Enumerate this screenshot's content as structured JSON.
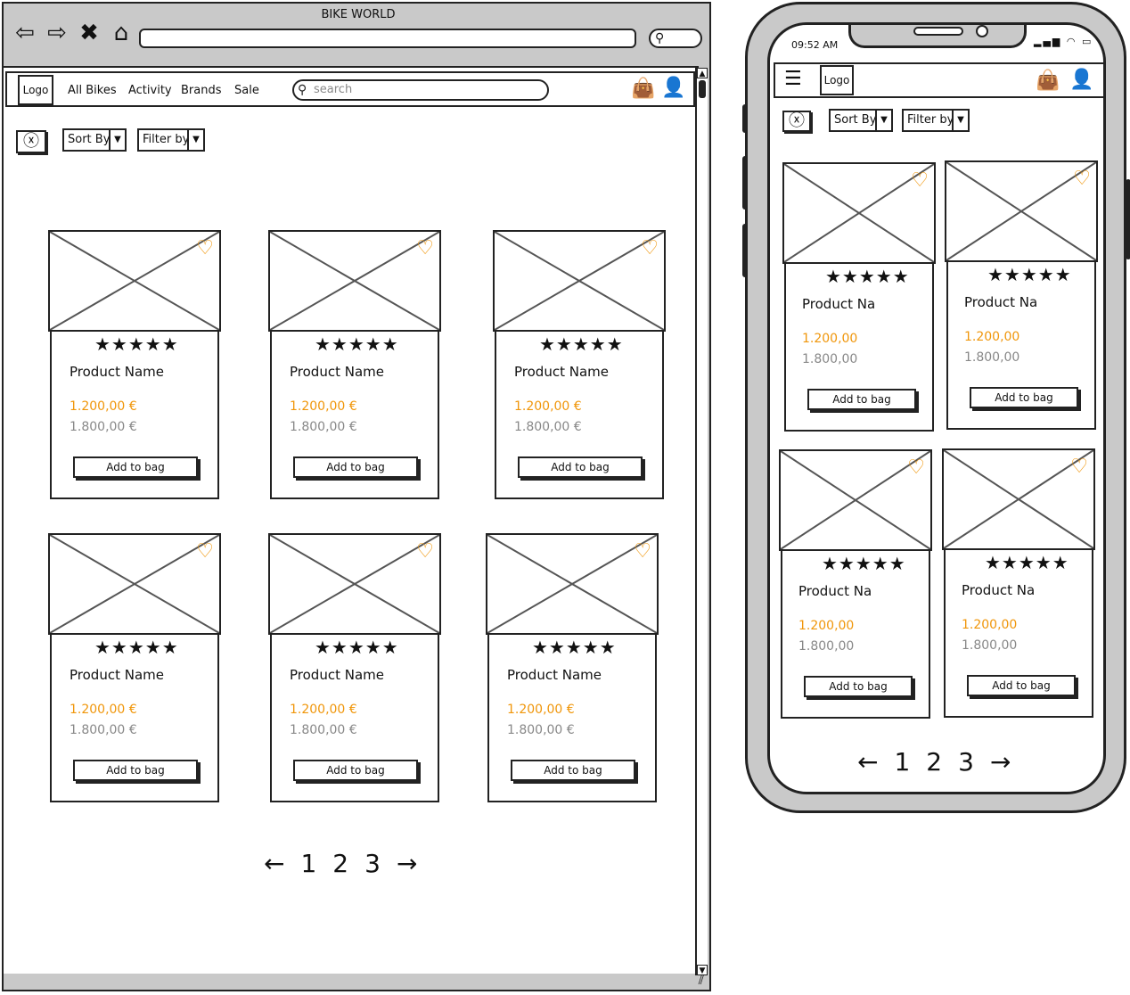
{
  "browser": {
    "title": "BIKE WORLD",
    "nav_icons": [
      "back-icon",
      "forward-icon",
      "stop-icon",
      "home-icon"
    ],
    "search_icon": "search-icon"
  },
  "site": {
    "logo": "Logo",
    "menu": [
      "All Bikes",
      "Activity",
      "Brands",
      "Sale"
    ],
    "search_placeholder": "search",
    "icons": [
      "shopping-bag-icon",
      "user-icon"
    ]
  },
  "filters": {
    "clear_icon": "clear-filter-icon",
    "sort_label": "Sort By",
    "filter_label": "Filter by"
  },
  "desktop_products": [
    {
      "name": "Product Name",
      "price": "1.200,00 €",
      "old_price": "1.800,00 €",
      "rating": "★★★★★",
      "button": "Add to bag"
    },
    {
      "name": "Product Name",
      "price": "1.200,00 €",
      "old_price": "1.800,00 €",
      "rating": "★★★★★",
      "button": "Add to bag"
    },
    {
      "name": "Product Name",
      "price": "1.200,00 €",
      "old_price": "1.800,00 €",
      "rating": "★★★★★",
      "button": "Add to bag"
    },
    {
      "name": "Product Name",
      "price": "1.200,00 €",
      "old_price": "1.800,00 €",
      "rating": "★★★★★",
      "button": "Add to bag"
    },
    {
      "name": "Product Name",
      "price": "1.200,00 €",
      "old_price": "1.800,00 €",
      "rating": "★★★★★",
      "button": "Add to bag"
    },
    {
      "name": "Product Name",
      "price": "1.200,00 €",
      "old_price": "1.800,00 €",
      "rating": "★★★★★",
      "button": "Add to bag"
    }
  ],
  "pagination": {
    "prev": "←",
    "pages": [
      "1",
      "2",
      "3"
    ],
    "next": "→"
  },
  "phone": {
    "time": "09:52 AM",
    "status_icons": "▂▄▆ ◠ ▭",
    "menu_icon": "hamburger-icon",
    "logo": "Logo",
    "sort_label": "Sort By",
    "filter_label": "Filter by",
    "products": [
      {
        "name": "Product Na",
        "price": "1.200,00",
        "old_price": "1.800,00",
        "rating": "★★★★★",
        "button": "Add to bag"
      },
      {
        "name": "Product Na",
        "price": "1.200,00",
        "old_price": "1.800,00",
        "rating": "★★★★★",
        "button": "Add to bag"
      },
      {
        "name": "Product Na",
        "price": "1.200,00",
        "old_price": "1.800,00",
        "rating": "★★★★★",
        "button": "Add to bag"
      },
      {
        "name": "Product Na",
        "price": "1.200,00",
        "old_price": "1.800,00",
        "rating": "★★★★★",
        "button": "Add to bag"
      }
    ]
  },
  "colors": {
    "accent": "#f0960a",
    "muted": "#888888",
    "frame": "#c9c9c9"
  }
}
